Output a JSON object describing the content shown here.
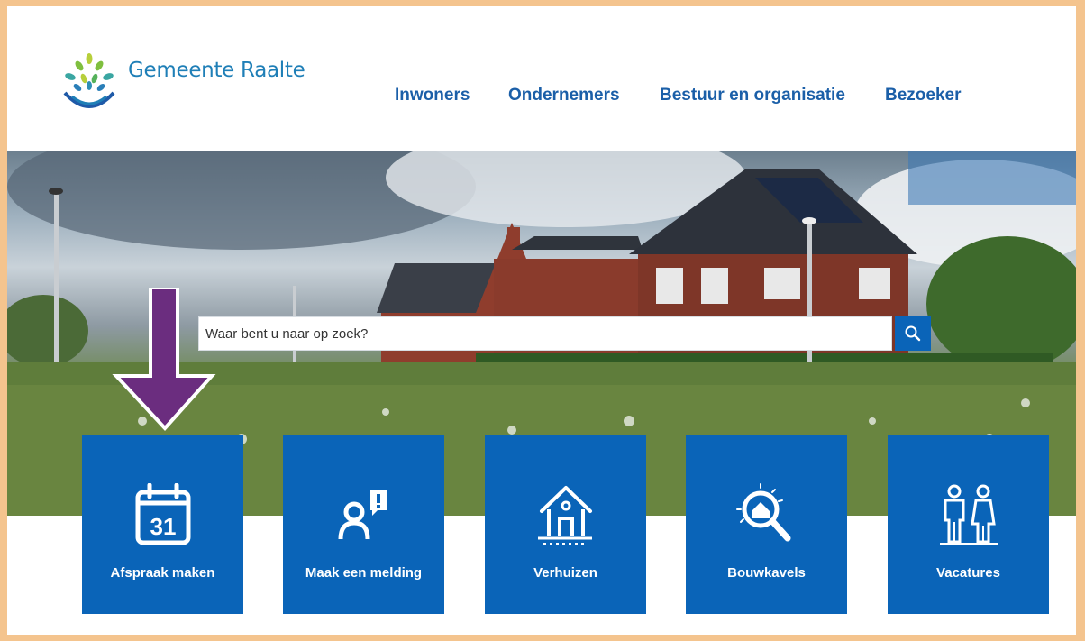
{
  "site": {
    "name": "Gemeente Raalte"
  },
  "nav": {
    "items": [
      {
        "label": "Inwoners"
      },
      {
        "label": "Ondernemers"
      },
      {
        "label": "Bestuur en organisatie"
      },
      {
        "label": "Bezoeker"
      }
    ]
  },
  "search": {
    "placeholder": "Waar bent u naar op zoek?"
  },
  "tiles": [
    {
      "label": "Afspraak maken",
      "icon": "calendar-icon",
      "day": "31"
    },
    {
      "label": "Maak een melding",
      "icon": "report-person-icon"
    },
    {
      "label": "Verhuizen",
      "icon": "house-icon"
    },
    {
      "label": "Bouwkavels",
      "icon": "house-search-icon"
    },
    {
      "label": "Vacatures",
      "icon": "people-icon"
    }
  ],
  "colors": {
    "brand_blue": "#0a64b8",
    "nav_blue": "#1b5fa8",
    "arrow_purple": "#6b2d7f",
    "frame": "#f4c48e"
  }
}
